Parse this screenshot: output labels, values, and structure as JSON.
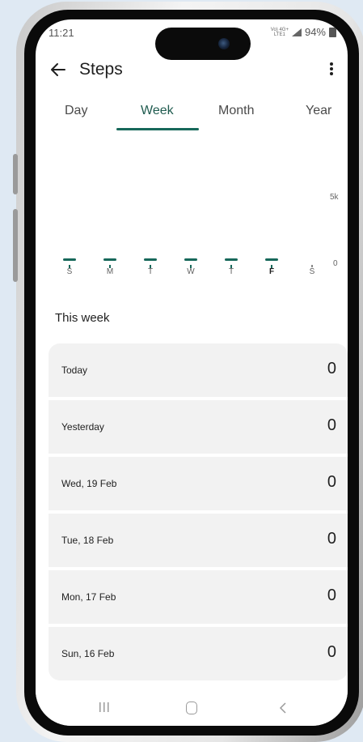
{
  "status_bar": {
    "time": "11:21",
    "network_top": "Vo) 4G+",
    "network_bottom": "LTE1",
    "battery": "94%"
  },
  "app_bar": {
    "title": "Steps"
  },
  "tabs": [
    "Day",
    "Week",
    "Month",
    "Year"
  ],
  "active_tab": "Week",
  "chart_data": {
    "type": "bar",
    "categories": [
      "S",
      "M",
      "T",
      "W",
      "T",
      "F",
      "S"
    ],
    "values": [
      0,
      0,
      0,
      0,
      0,
      0,
      0
    ],
    "highlighted_category_index": 5,
    "y_ticks": [
      "5k",
      "0"
    ],
    "ylim": [
      0,
      5000
    ]
  },
  "section": {
    "title": "This week"
  },
  "entries": [
    {
      "label": "Today",
      "value": "0"
    },
    {
      "label": "Yesterday",
      "value": "0"
    },
    {
      "label": "Wed, 19 Feb",
      "value": "0"
    },
    {
      "label": "Tue, 18 Feb",
      "value": "0"
    },
    {
      "label": "Mon, 17 Feb",
      "value": "0"
    },
    {
      "label": "Sun, 16 Feb",
      "value": "0"
    }
  ],
  "colors": {
    "accent": "#17685a",
    "card_background": "#f2f2f2",
    "page_background": "#dfe9f3"
  },
  "icons": {
    "back": "back-arrow-icon",
    "more": "more-vert-icon",
    "nav_recent": "recent-apps-icon",
    "nav_home": "home-icon",
    "nav_back": "nav-back-icon"
  }
}
